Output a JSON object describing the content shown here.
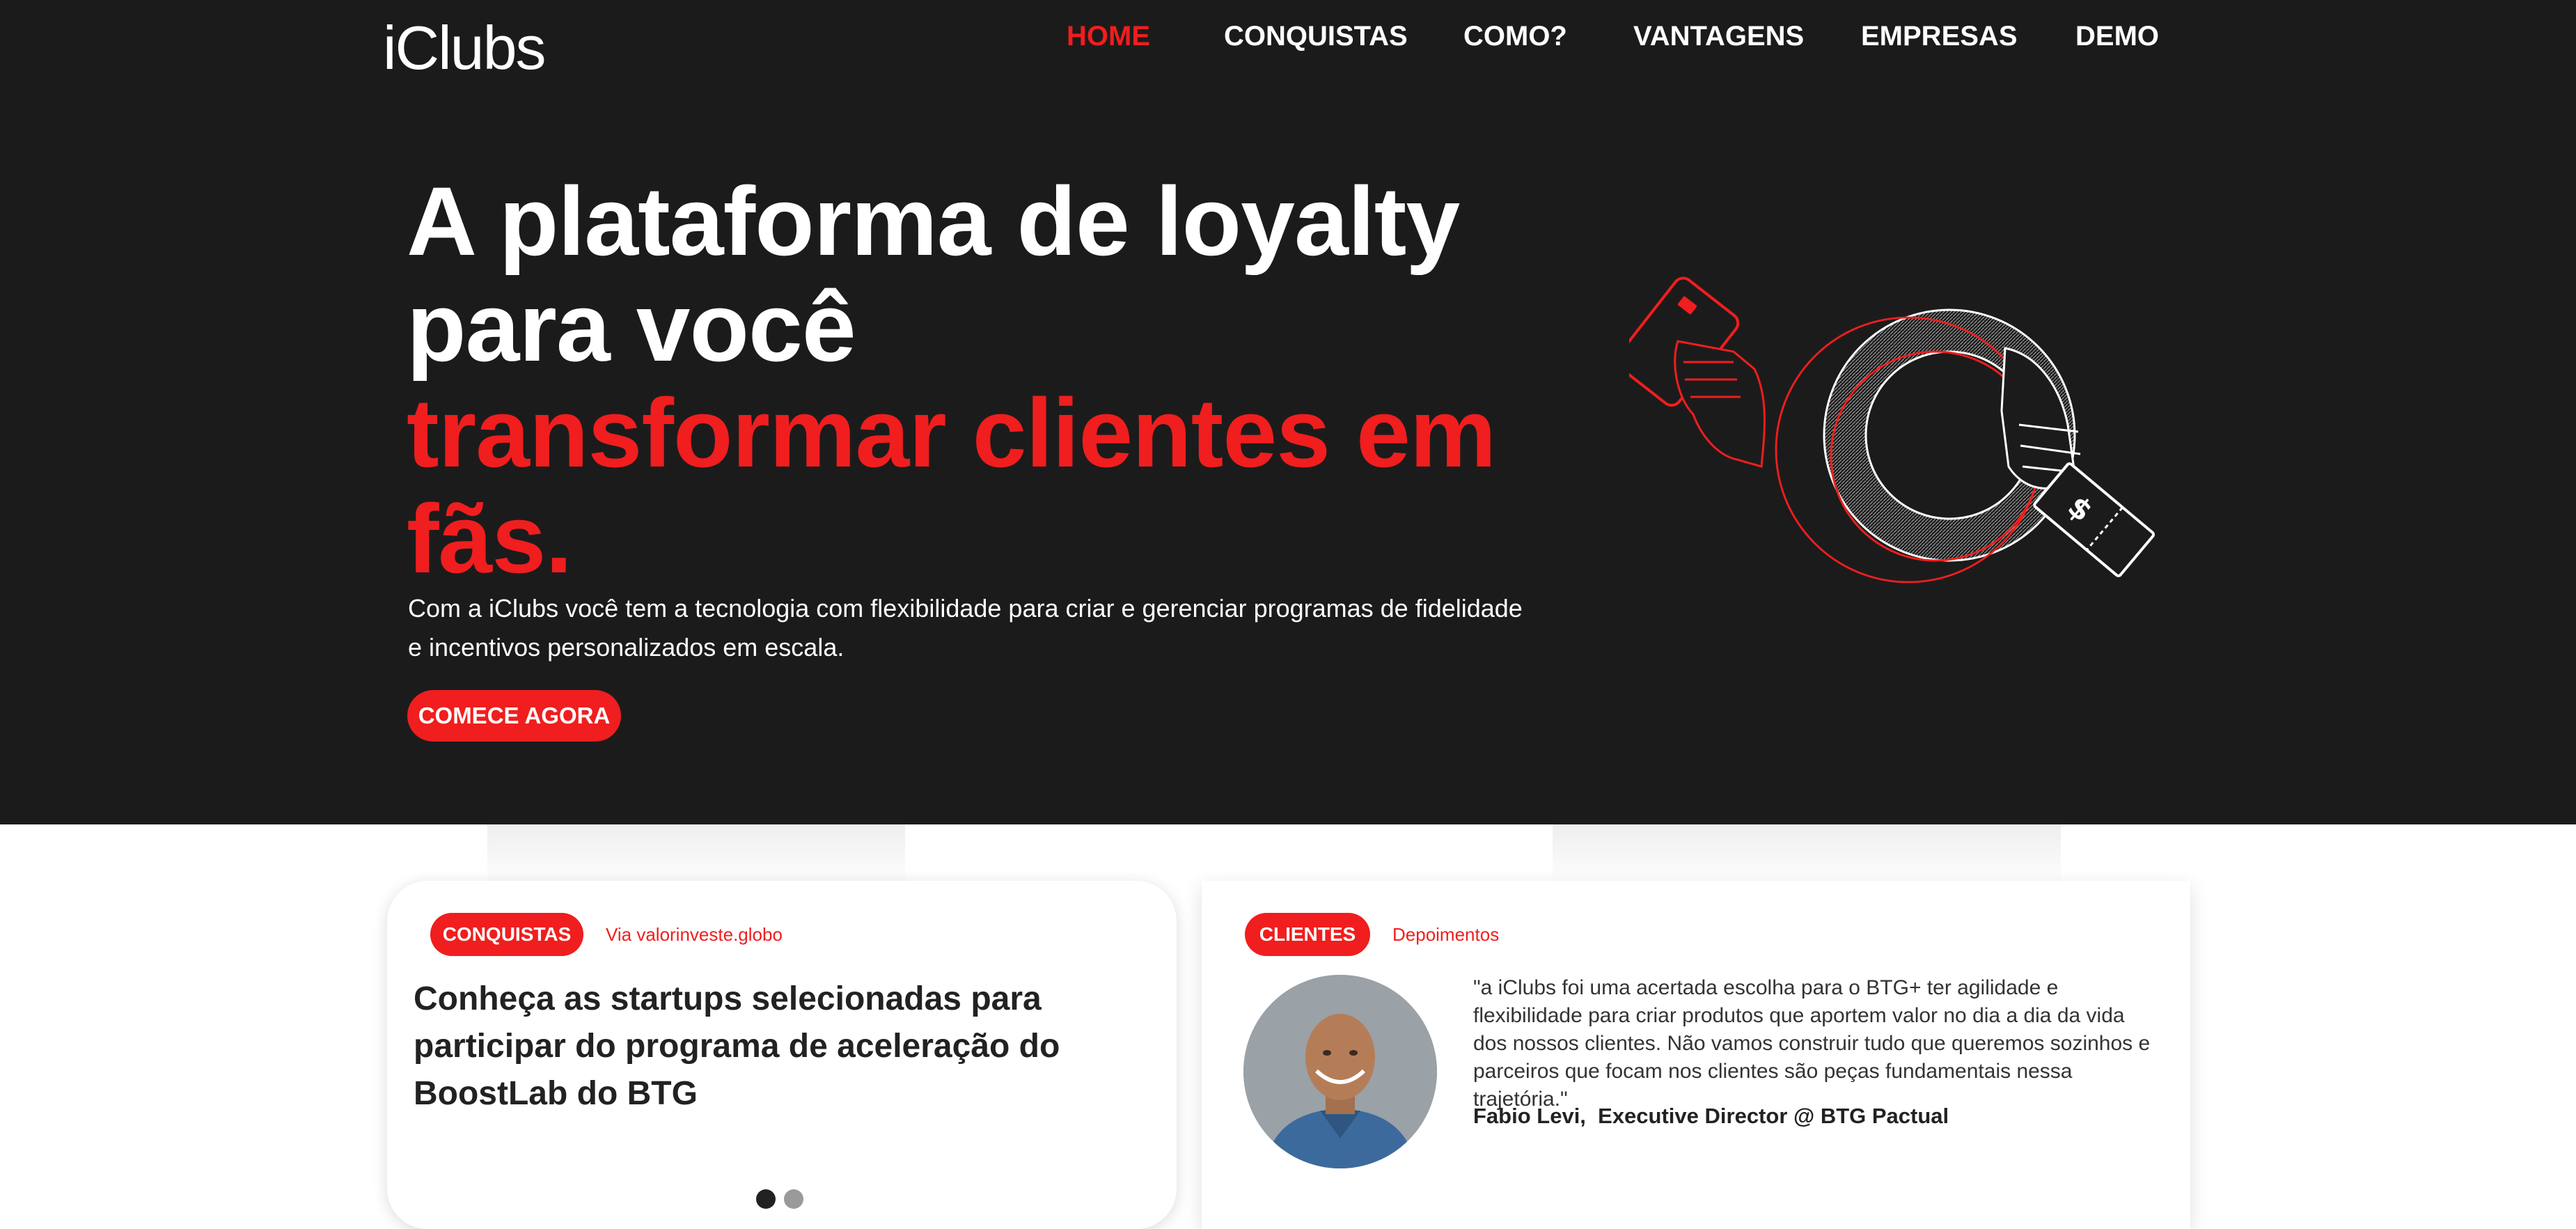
{
  "brand": {
    "logo_text": "iClubs"
  },
  "nav": {
    "items": [
      {
        "label": "HOME",
        "active": true
      },
      {
        "label": "CONQUISTAS"
      },
      {
        "label": "COMO?"
      },
      {
        "label": "VANTAGENS"
      },
      {
        "label": "EMPRESAS"
      },
      {
        "label": "DEMO"
      }
    ]
  },
  "hero": {
    "headline_white_1": "A plataforma de loyalty",
    "headline_white_2": "para você",
    "headline_red_1": "transformar clientes em",
    "headline_red_2": "fãs.",
    "subtitle": "Com a iClubs você tem a tecnologia com flexibilidade para criar e gerenciar programas de fidelidade e incentivos personalizados em escala.",
    "cta_label": "COMECE AGORA",
    "illustration_icon": "hand-card-ring-ticket-illustration"
  },
  "news_card": {
    "tag": "CONQUISTAS",
    "source": "Via valorinveste.globo",
    "title": "Conheça as startups selecionadas para participar do programa de aceleração do BoostLab do BTG",
    "carousel_total": 2,
    "carousel_active": 1
  },
  "testimonial_card": {
    "tag": "CLIENTES",
    "subtitle": "Depoimentos",
    "quote": "\"a iClubs foi uma acertada escolha para o BTG+ ter agilidade e flexibilidade para criar produtos que aportem valor no dia a dia da vida dos nossos clientes. Não vamos construir tudo que queremos sozinhos e parceiros que focam nos clientes são peças fundamentais nessa trajetória.\"",
    "author": "Fabio Levi,  Executive Director @ BTG Pactual"
  },
  "colors": {
    "accent": "#f01e1e",
    "hero_bg": "#1c1b1c",
    "text_dark": "#222222"
  }
}
